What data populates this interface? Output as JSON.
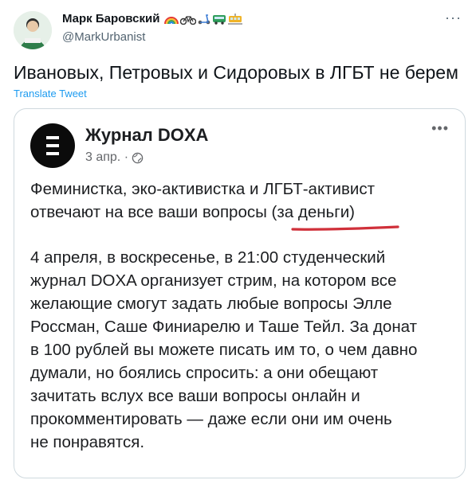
{
  "tweet": {
    "author_name": "Марк Баровский",
    "name_emojis": [
      "rainbow-emoji",
      "bicycle-emoji",
      "scooter-emoji",
      "bus-emoji",
      "tram-emoji"
    ],
    "author_handle": "@MarkUrbanist",
    "text": "Ивановых, Петровых и Сидоровых в ЛГБТ не берем",
    "translate_label": "Translate Tweet",
    "more_label": "···"
  },
  "embedded_post": {
    "source_name": "Журнал DOXA",
    "date": "3 апр. ·",
    "more_label": "•••",
    "paragraph1_lines": [
      "Феминистка, эко-активистка и ЛГБТ-активист",
      "отвечают на все ваши вопросы (за деньги)"
    ],
    "paragraph2_lines": [
      "4 апреля, в воскресенье, в 21:00 студенческий",
      "журнал DOXA организует стрим, на котором все",
      "желающие смогут задать любые вопросы Элле",
      "Россман, Саше Финиарелю и Таше Тейл. За донат",
      "в 100 рублей вы можете писать им то, о чем давно",
      "думали, но боялись спросить: а они обещают",
      "зачитать вслух все ваши вопросы онлайн и",
      "прокомментировать —  даже если они им очень",
      "не понравятся."
    ]
  },
  "colors": {
    "link": "#1d9bf0",
    "secondary_text": "#536471",
    "underline": "#d0303a",
    "logo_bg": "#0b0b0b"
  }
}
